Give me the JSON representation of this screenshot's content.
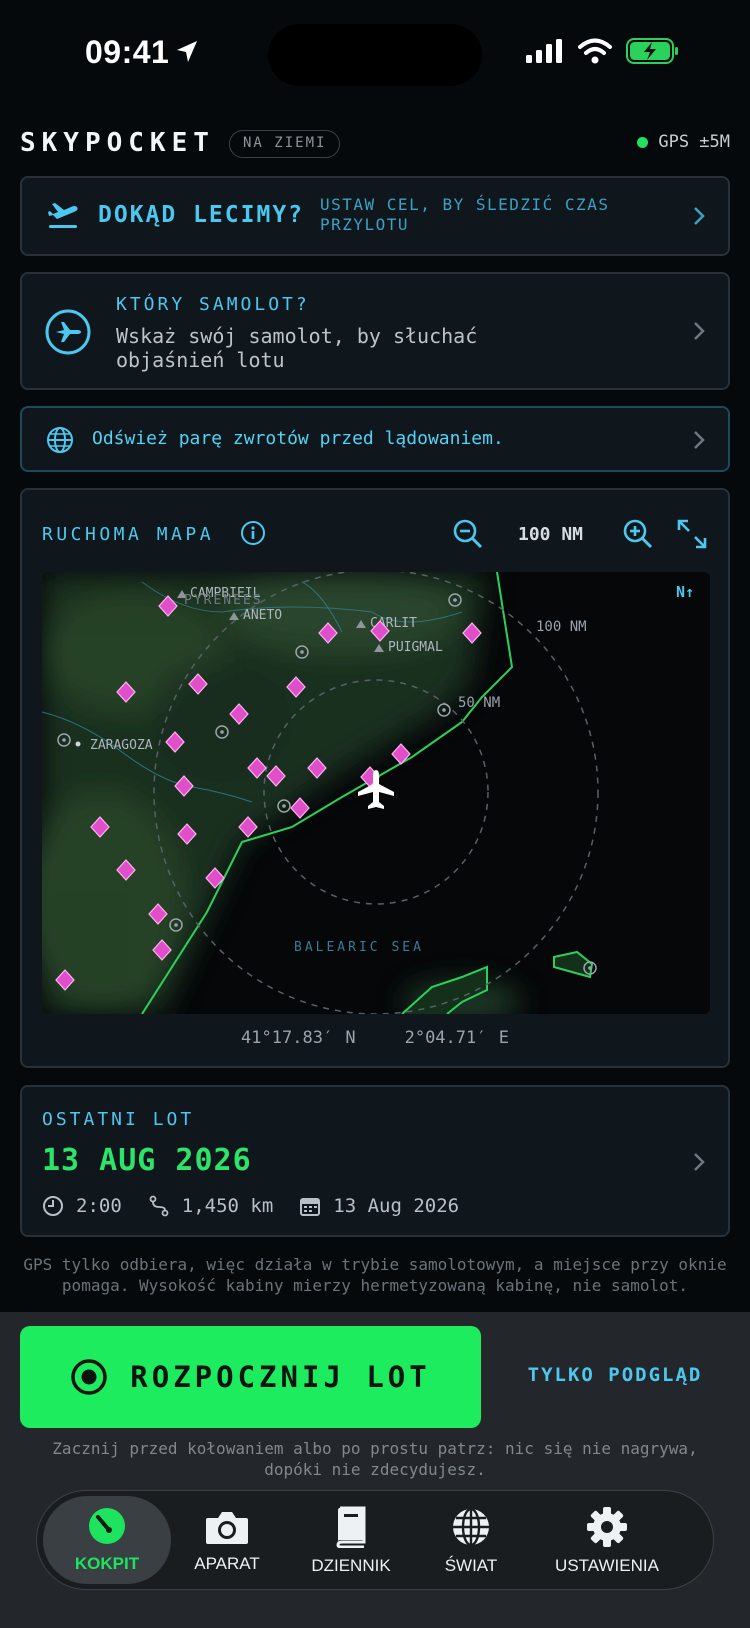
{
  "status_bar": {
    "time": "09:41"
  },
  "header": {
    "brand": "SKYPOCKET",
    "badge": "NA ZIEMI",
    "gps": "GPS ±5M"
  },
  "destination": {
    "title": "DOKĄD LECIMY?",
    "subtitle": "USTAW CEL, BY ŚLEDZIĆ CZAS PRZYLOTU"
  },
  "aircraft": {
    "title": "KTÓRY SAMOLOT?",
    "subtitle": "Wskaż swój samolot, by słuchać objaśnień lotu"
  },
  "phrase_banner": {
    "text": "Odśwież parę zwrotów przed lądowaniem."
  },
  "map": {
    "title": "RUCHOMA MAPA",
    "zoom": "100 NM",
    "north": "N↑",
    "ring_outer": "100 NM",
    "ring_inner": "50 NM",
    "places": [
      "CAMPBIEIL",
      "PYRENEES",
      "ANETO",
      "CARLIT",
      "PUIGMAL",
      "ZARAGOZA",
      "BALEARIC SEA"
    ],
    "latitude": "41°17.83′ N",
    "longitude": "2°04.71′ E",
    "colors": {
      "airport": "#e04fc9",
      "coast": "#2bd15c",
      "ring": "#5a6066"
    }
  },
  "last_flight": {
    "title": "OSTATNI LOT",
    "date": "13 AUG 2026",
    "duration": "2:00",
    "distance": "1,450 km",
    "calendar_date": "13 Aug 2026"
  },
  "disclaimer": "GPS tylko odbiera, więc działa w trybie samolotowym, a miejsce przy oknie pomaga. Wysokość kabiny mierzy hermetyzowaną kabinę, nie samolot.",
  "actions": {
    "start": "ROZPOCZNIJ LOT",
    "preview": "TYLKO PODGLĄD",
    "hint": "Zacznij przed kołowaniem albo po prostu patrz: nic się nie nagrywa, dopóki nie zdecydujesz."
  },
  "tabs": [
    "KOKPIT",
    "APARAT",
    "DZIENNIK",
    "ŚWIAT",
    "USTAWIENIA"
  ],
  "theme": {
    "accent": "#4cc8ef",
    "go": "#1cec5e"
  }
}
